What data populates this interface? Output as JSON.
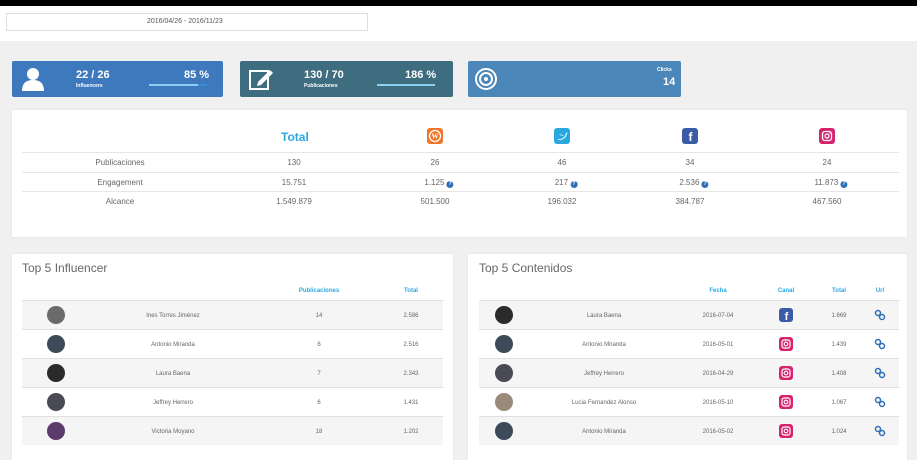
{
  "header": {
    "date_range": "2016/04/26 - 2016/11/23"
  },
  "stats": {
    "influencers": {
      "value": "22 / 26",
      "label": "Influencers",
      "percent": "85 %",
      "progress": 0.85
    },
    "publicaciones": {
      "value": "130 / 70",
      "label": "Publicaciones",
      "percent": "186 %",
      "progress": 1.0
    },
    "clicks": {
      "label": "Clicks",
      "value": "14"
    }
  },
  "summary": {
    "total_header": "Total",
    "rows": [
      {
        "label": "Publicaciones",
        "total": "130",
        "wordpress": "26",
        "twitter": "46",
        "facebook": "34",
        "instagram": "24"
      },
      {
        "label": "Engagement",
        "total": "15.751",
        "wordpress": "1.125",
        "twitter": "217",
        "facebook": "2.536",
        "instagram": "11.873"
      },
      {
        "label": "Alcance",
        "total": "1.549.879",
        "wordpress": "501.500",
        "twitter": "196.032",
        "facebook": "384.787",
        "instagram": "467.560"
      }
    ]
  },
  "colors": {
    "wordpress": "#f0752a",
    "twitter": "#2aa9e0",
    "facebook": "#3b5ba6",
    "instagram": "#d6246d",
    "accent": "#2aa9e0"
  },
  "top_influencers": {
    "title": "Top 5 Influencer",
    "col_publicaciones": "Publicaciones",
    "col_total": "Total",
    "rows": [
      {
        "name": "Ines Torres Jiménez",
        "publicaciones": "14",
        "total": "2.586"
      },
      {
        "name": "Antonio Miranda",
        "publicaciones": "6",
        "total": "2.516"
      },
      {
        "name": "Laura Baena",
        "publicaciones": "7",
        "total": "2.343"
      },
      {
        "name": "Jeffrey Herrero",
        "publicaciones": "6",
        "total": "1.431"
      },
      {
        "name": "Victoria Moyano",
        "publicaciones": "18",
        "total": "1.202"
      }
    ]
  },
  "top_contenidos": {
    "title": "Top 5 Contenidos",
    "col_fecha": "Fecha",
    "col_canal": "Canal",
    "col_total": "Total",
    "col_url": "Url",
    "rows": [
      {
        "name": "Laura Baena",
        "fecha": "2016-07-04",
        "canal": "facebook",
        "total": "1.669"
      },
      {
        "name": "Antonio Miranda",
        "fecha": "2016-05-01",
        "canal": "instagram",
        "total": "1.439"
      },
      {
        "name": "Jeffrey Herrero",
        "fecha": "2016-04-29",
        "canal": "instagram",
        "total": "1.408"
      },
      {
        "name": "Lucia Fernandez Alonso",
        "fecha": "2016-05-10",
        "canal": "instagram",
        "total": "1.067"
      },
      {
        "name": "Antonio Miranda",
        "fecha": "2016-05-02",
        "canal": "instagram",
        "total": "1.024"
      }
    ]
  }
}
